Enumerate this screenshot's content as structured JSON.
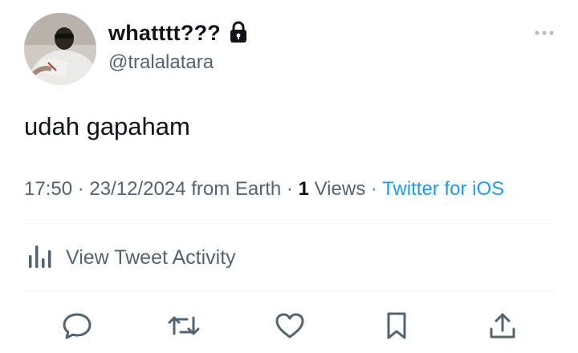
{
  "author": {
    "display_name": "whatttt???",
    "handle": "@tralalatara",
    "protected": true,
    "avatar": "profile-photo"
  },
  "tweet": {
    "text": "udah gapaham"
  },
  "meta": {
    "time": "17:50",
    "date": "23/12/2024",
    "location": "from Earth",
    "separator": "·",
    "views_count": "1",
    "views_label": "Views",
    "source": "Twitter for iOS"
  },
  "activity": {
    "label": "View Tweet Activity",
    "icon": "bar-chart-icon"
  },
  "actions": [
    {
      "name": "reply",
      "icon": "speech-bubble-icon"
    },
    {
      "name": "retweet",
      "icon": "retweet-arrows-icon"
    },
    {
      "name": "like",
      "icon": "heart-icon"
    },
    {
      "name": "bookmark",
      "icon": "bookmark-icon"
    },
    {
      "name": "share",
      "icon": "share-upload-icon"
    }
  ],
  "colors": {
    "text": "#0f1419",
    "secondary": "#536471",
    "link": "#1d9bf0",
    "divider": "#eff3f4"
  }
}
